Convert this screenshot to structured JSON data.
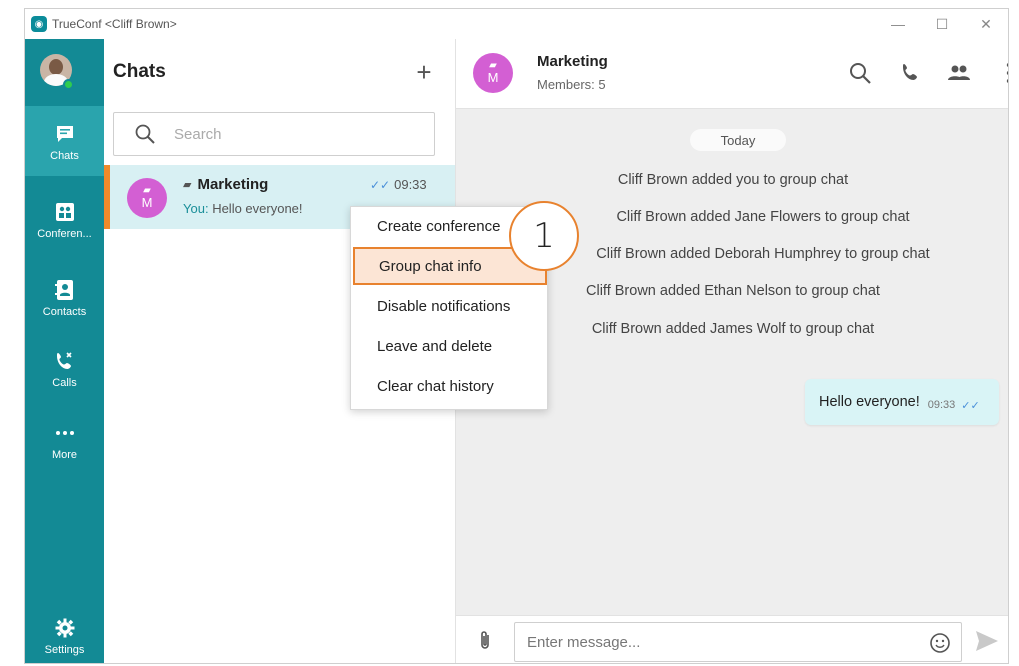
{
  "window": {
    "title": "TrueConf <Cliff Brown>",
    "controls": {
      "minimize": "—",
      "maximize": "☐",
      "close": "✕"
    }
  },
  "rail": {
    "items": [
      {
        "label": "Chats",
        "icon": "chat-icon",
        "active": true
      },
      {
        "label": "Conferen...",
        "icon": "conference-icon",
        "active": false
      },
      {
        "label": "Contacts",
        "icon": "contacts-icon",
        "active": false
      },
      {
        "label": "Calls",
        "icon": "calls-icon",
        "active": false
      },
      {
        "label": "More",
        "icon": "more-icon",
        "active": false
      },
      {
        "label": "Settings",
        "icon": "gear-icon",
        "active": false
      }
    ]
  },
  "chats": {
    "title": "Chats",
    "add_label": "+",
    "search_placeholder": "Search",
    "list": [
      {
        "name": "Marketing",
        "avatar_letter": "M",
        "preview_prefix": "You:",
        "preview_text": "Hello everyone!",
        "time": "09:33",
        "ticks": "✓✓"
      }
    ]
  },
  "context_menu": {
    "items": [
      "Create conference",
      "Group chat info",
      "Disable notifications",
      "Leave and delete",
      "Clear chat history"
    ],
    "highlighted": "Group chat info"
  },
  "step_marker": "1",
  "conversation": {
    "title": "Marketing",
    "subtitle": "Members: 5",
    "avatar_letter": "M",
    "date_label": "Today",
    "system_messages": [
      "Cliff Brown added you to group chat",
      "Cliff Brown added Jane Flowers to group chat",
      "Cliff Brown added Deborah Humphrey to group chat",
      "Cliff Brown added Ethan Nelson to group chat",
      "Cliff Brown added James Wolf to group chat"
    ],
    "messages": [
      {
        "text": "Hello everyone!",
        "time": "09:33",
        "ticks": "✓✓"
      }
    ],
    "input_placeholder": "Enter message..."
  },
  "colors": {
    "rail_bg": "#138a95",
    "rail_active": "#2aa4ad",
    "accent_orange": "#e8822e",
    "avatar_purple": "#d35fd3",
    "selected_row": "#d8f0f3",
    "bubble_bg": "#d9f4f6"
  }
}
